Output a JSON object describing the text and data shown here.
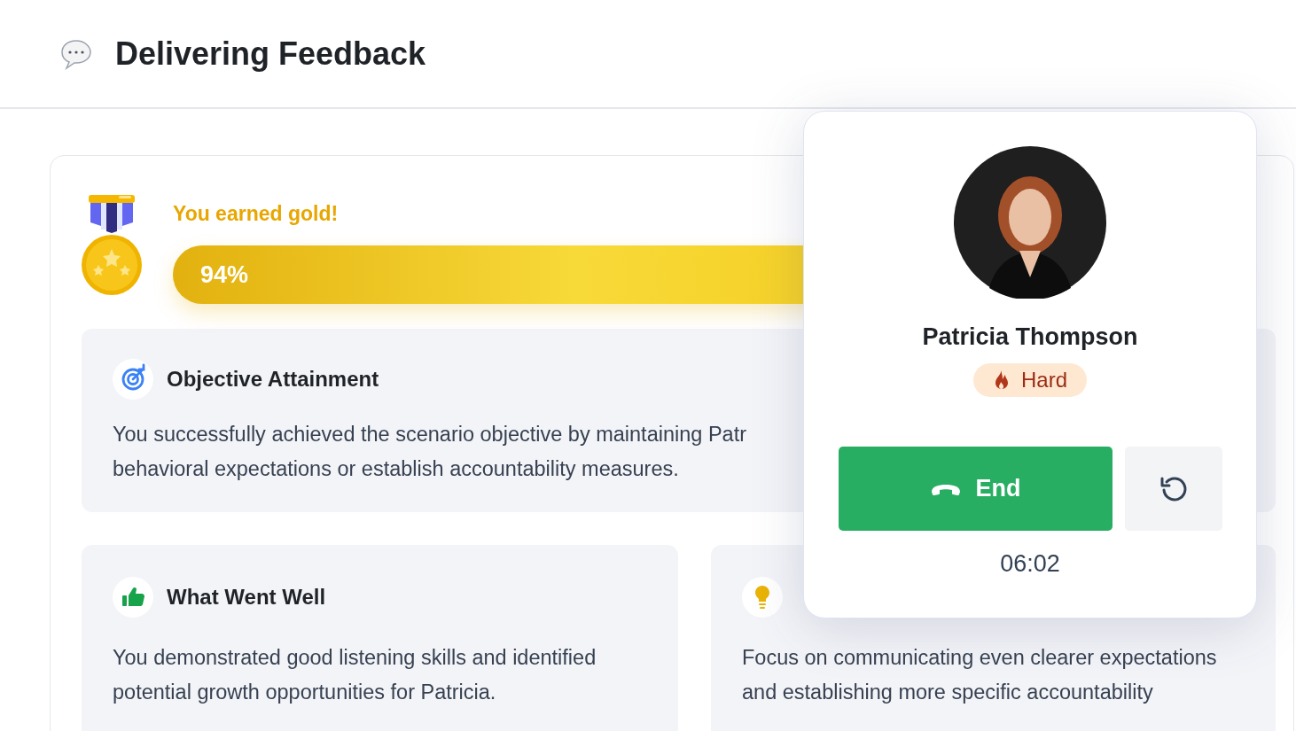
{
  "header": {
    "title": "Delivering Feedback"
  },
  "result": {
    "message": "You earned gold!",
    "progress": {
      "level": 0.94,
      "reading": "94%"
    }
  },
  "objective": {
    "title": "Objective Attainment",
    "lines": [
      "You successfully achieved the scenario objective by maintaining Patr",
      "behavioral expectations or establish accountability measures."
    ]
  },
  "feedback_cards": [
    {
      "kind": "strength",
      "title": "What Went Well",
      "text": "You demonstrated good listening skills and identified potential growth opportunities for Patricia."
    },
    {
      "kind": "improvement",
      "text": "Focus on communicating even clearer expectations and establishing more specific accountability"
    }
  ],
  "call": {
    "name": "Patricia Thompson",
    "difficulty": "Hard",
    "end_button": "End",
    "timer": "06:02"
  }
}
